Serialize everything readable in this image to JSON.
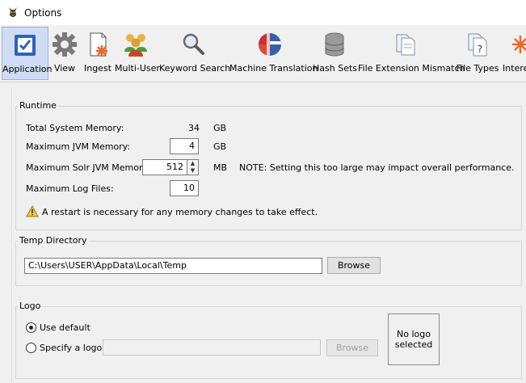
{
  "window": {
    "title": "Options",
    "app_icon": "autopsy-dog-icon"
  },
  "toolbar": {
    "items": [
      {
        "label": "Application",
        "icon": "application-checkbox-icon",
        "selected": true
      },
      {
        "label": "View",
        "icon": "gear-icon"
      },
      {
        "label": "Ingest",
        "icon": "ingest-document-icon"
      },
      {
        "label": "Multi-User",
        "icon": "users-group-icon"
      },
      {
        "label": "Keyword Search",
        "icon": "magnifier-icon"
      },
      {
        "label": "Machine Translation",
        "icon": "globe-flags-icon"
      },
      {
        "label": "Hash Sets",
        "icon": "database-icon"
      },
      {
        "label": "File Extension Mismatch",
        "icon": "file-mismatch-icon"
      },
      {
        "label": "File Types",
        "icon": "file-question-icon"
      },
      {
        "label": "Intere",
        "icon": "star-icon"
      }
    ]
  },
  "runtime": {
    "title": "Runtime",
    "total_memory_label": "Total System Memory:",
    "total_memory_value": "34",
    "total_memory_unit": "GB",
    "jvm_label": "Maximum JVM Memory:",
    "jvm_value": "4",
    "jvm_unit": "GB",
    "solr_label": "Maximum Solr JVM Memory:",
    "solr_value": "512",
    "solr_unit": "MB",
    "solr_note": "NOTE:  Setting this too large may impact overall performance.",
    "log_label": "Maximum Log Files:",
    "log_value": "10",
    "warning_text": "A restart is necessary for any memory changes to take effect."
  },
  "temp": {
    "title": "Temp Directory",
    "path_value": "C:\\Users\\USER\\AppData\\Local\\Temp",
    "browse_label": "Browse"
  },
  "logo": {
    "title": "Logo",
    "use_default_label": "Use default",
    "use_default_selected": true,
    "specify_label": "Specify a logo",
    "specify_path": "",
    "browse_label": "Browse",
    "preview_text": "No logo selected"
  }
}
